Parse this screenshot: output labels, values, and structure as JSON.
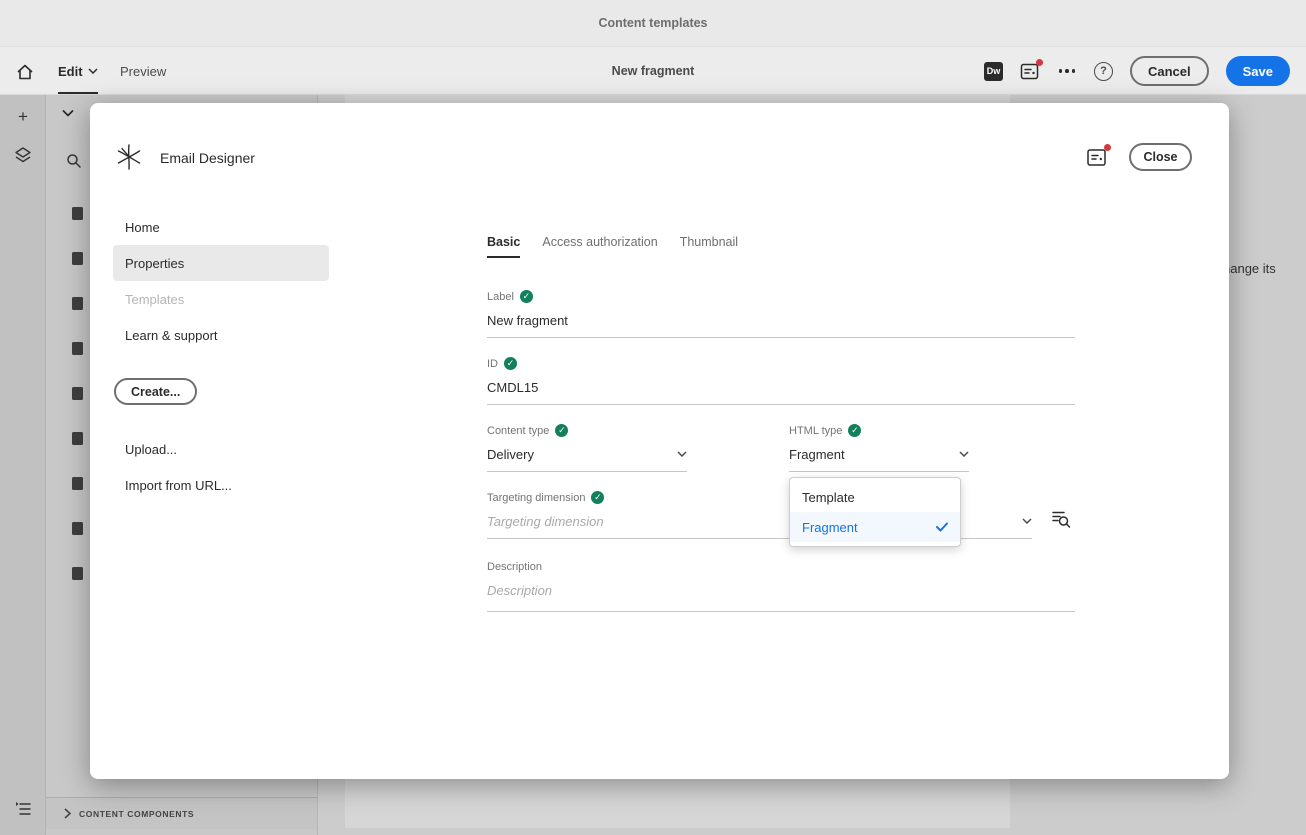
{
  "top_bar": {
    "title": "Content templates"
  },
  "toolbar": {
    "edit_label": "Edit",
    "preview_label": "Preview",
    "doc_title": "New fragment",
    "dw_badge": "Dw",
    "cancel_label": "Cancel",
    "save_label": "Save"
  },
  "left_panel": {
    "footer_label": "CONTENT COMPONENTS"
  },
  "canvas": {
    "partial_text": "hange its"
  },
  "modal": {
    "title": "Email Designer",
    "close_label": "Close",
    "nav": {
      "items": [
        {
          "label": "Home",
          "state": "normal"
        },
        {
          "label": "Properties",
          "state": "selected"
        },
        {
          "label": "Templates",
          "state": "disabled"
        },
        {
          "label": "Learn & support",
          "state": "normal"
        }
      ],
      "create_label": "Create...",
      "upload_label": "Upload...",
      "import_label": "Import from URL..."
    },
    "tabs": [
      {
        "label": "Basic",
        "selected": true
      },
      {
        "label": "Access authorization",
        "selected": false
      },
      {
        "label": "Thumbnail",
        "selected": false
      }
    ],
    "form": {
      "label_field": {
        "label": "Label",
        "value": "New fragment",
        "valid": true
      },
      "id_field": {
        "label": "ID",
        "value": "CMDL15",
        "valid": true
      },
      "content_type_field": {
        "label": "Content type",
        "value": "Delivery",
        "valid": true
      },
      "html_type_field": {
        "label": "HTML type",
        "value": "Fragment",
        "valid": true,
        "options": [
          {
            "label": "Template",
            "selected": false
          },
          {
            "label": "Fragment",
            "selected": true
          }
        ]
      },
      "targeting_field": {
        "label": "Targeting dimension",
        "placeholder": "Targeting dimension",
        "valid": true
      },
      "description_field": {
        "label": "Description",
        "placeholder": "Description"
      }
    }
  },
  "colors": {
    "accent": "#1473e6",
    "success": "#12805c",
    "alert": "#d7373f"
  }
}
